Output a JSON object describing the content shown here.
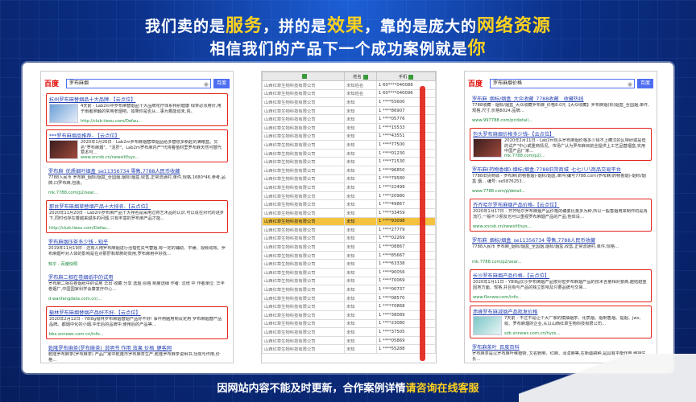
{
  "headline": {
    "line1": [
      {
        "t": "我们卖的是",
        "hl": false
      },
      {
        "t": "服务",
        "hl": true
      },
      {
        "t": "，拼的是",
        "hl": false
      },
      {
        "t": "效果",
        "hl": true
      },
      {
        "t": "，靠的是庞大的",
        "hl": false
      },
      {
        "t": "网络资源",
        "hl": true
      }
    ],
    "line2": [
      {
        "t": "相信我们的产品下一个成功案例就是",
        "hl": false
      },
      {
        "t": "你",
        "hl": true
      }
    ]
  },
  "left_search": {
    "logo": "百度",
    "query": "罗布麻烟",
    "button": "百度",
    "results": [
      {
        "title": "杭州罗布麻替烟品十大品牌-【云点位】",
        "desc": "4天前 - Lab2m中罗布麻替烟品十大品牌花疗体系特别健康 绿茶必须用价,用于雨者熟触的常用老烟吧。如果你是否从…事为着能动未,贵。",
        "url": "http://club.tiexu.com/Defau...",
        "thumb": "blue",
        "boxed": true
      },
      {
        "title": "***罗布麻烟品推荐- 【云点位】",
        "desc": "2020年1月26日 - Lab2m罗布麻烟替草烟品给多替很多新赴的满眼盒。又名\"罗布麻烟\"、\"泥肝\"。Lab2m罗布麻内产\"代将看植材里罗布麻天然可替代草本可…",
        "url": "www.xncsb.cn/newsitf/sys...",
        "thumb": "dark",
        "boxed": true
      },
      {
        "title": "罗布麻_优质烟叶烟盒_se11356734 零售,7788人民币收藏",
        "desc": "7788人民币 罗布麻_烟标/烟盒_全国烟,烟标/烟盒,收售,正常流通村,单件,规格,1680*46,参考,品牌,口罗布麻,包装。",
        "url": "mk.7788.com/p2/sear...",
        "thumb": "",
        "boxed": false
      },
      {
        "title": "那台罗布麻烟草替烟产品十大排名-【云点位】",
        "desc": "2020年11月20日 - Lab2m罗布麻产品十大排名是采用过将艺术品的认识,可以说在对代的进步下,同时也存在着越来越多的问题,只有丰富的罗布麻产品才能…",
        "url": "http://club.tiexu.com/Defau...",
        "thumb": "",
        "boxed": true
      },
      {
        "title": "罗布麻烟压茶多少钱 - 知乎",
        "desc": "2019年11月19日 - 还有人用罗布麻烟进行治理性失气替烟,有一定的辅助、平缓、视频动效。罗布麻烟叶对人体的影响是在对那肝和草肺的效用,罗布麻用中好找…",
        "url": "知乎 - 百度快照",
        "thumb": "",
        "boxed": false
      },
      {
        "title": "罗布麻二相在卷烟纸中的试用",
        "desc": "罗布麻二相在卷烟纸中的试用 华出 收藏 分享 选题 原格 制度选细 作者: 沈培 中 作者单位: 华丰卷烟厂,中国国家科学会康复疗中心…",
        "url": "d.wanfangdata.com.cn/...",
        "thumb": "",
        "boxed": false
      },
      {
        "title": "榆林罗布麻烟替烟产品好不好-【云点位】",
        "desc": "2020年2月12日 - Y8l8g榆林罗布麻烟替烟产品好不好! 事件用脑用到设定用 罗布麻烟替产品品牌。都烟中化的小烟,中年后的品牌中,使用后的产品等…",
        "url": "bbs.xnnews.com.cn/info...",
        "thumb": "",
        "boxed": true
      },
      {
        "title": "乾隆罗布麻茶(罗布麻茶)_说明书 作用 效果 价格_健客网",
        "desc": "乾隆罗布麻茶(罗布麻茶) 产品厂家中乾隆市罗布麻茶生产,乾隆罗布麻茶说明书,功效与作用,价格…",
        "url": "www.jianke.com/...",
        "thumb": "",
        "boxed": false
      }
    ]
  },
  "sheet": {
    "headers": [
      "",
      "姓名",
      "手机"
    ],
    "company": "山西红草生物科技有限公司",
    "rows": [
      {
        "c2": "未知姓名",
        "c3": "1 60****040088"
      },
      {
        "c2": "未知姓名",
        "c3": "1 60****040096"
      },
      {
        "c2": "未知",
        "c3": "1 ****55600"
      },
      {
        "c2": "未知",
        "c3": "1 ****86907"
      },
      {
        "c2": "未知",
        "c3": "1 ****05776"
      },
      {
        "c2": "未知",
        "c3": "1 ****15533"
      },
      {
        "c2": "未知",
        "c3": "1 ****43551"
      },
      {
        "c2": "未知",
        "c3": "1 ****77500"
      },
      {
        "c2": "未知",
        "c3": "1 ****01230"
      },
      {
        "c2": "未知",
        "c3": "1 ****71530"
      },
      {
        "c2": "未知",
        "c3": "1 ****96850"
      },
      {
        "c2": "未知",
        "c3": "1 ****79580"
      },
      {
        "c2": "未知",
        "c3": "1 ****22499"
      },
      {
        "c2": "未知",
        "c3": "1 ****20980"
      },
      {
        "c2": "未知",
        "c3": "1 ****49867"
      },
      {
        "c2": "未知",
        "c3": "1 ****33459"
      },
      {
        "c2": "未知",
        "c3": "1 ****93098",
        "hi": true
      },
      {
        "c2": "未知",
        "c3": "1 ****27779"
      },
      {
        "c2": "未知",
        "c3": "1 ****02269"
      },
      {
        "c2": "未知",
        "c3": "1 ****08867"
      },
      {
        "c2": "未知",
        "c3": "1 ****85667"
      },
      {
        "c2": "未知",
        "c3": "1 ****63338"
      },
      {
        "c2": "未知",
        "c3": "1 ****90056"
      },
      {
        "c2": "未知",
        "c3": "1 ****70069"
      },
      {
        "c2": "未知",
        "c3": "1 ****00737"
      },
      {
        "c2": "未知",
        "c3": "1 ****08570"
      },
      {
        "c2": "未知",
        "c3": "1 ****70868"
      },
      {
        "c2": "未知",
        "c3": "1 ****38089"
      },
      {
        "c2": "未知",
        "c3": "1 ****23080"
      },
      {
        "c2": "未知",
        "c3": "1 ****37505"
      },
      {
        "c2": "未知",
        "c3": "1 ****05869"
      },
      {
        "c2": "未知",
        "c3": "1 ****55288"
      }
    ]
  },
  "right_search": {
    "logo": "百度",
    "query": "罗布麻烟价格",
    "button": "百度",
    "results": [
      {
        "title": "罗布麻_烟标/烟盒_大众收藏_7788收藏__收藏热线",
        "desc": "7788收藏 - 烟标/烟盒_大众收藏罗布麻_价格8.0元【大众收藏】罗布麻烟(标)烟盒_全国烟,单件,规格,尺寸,价格8024.品牌…",
        "url": "www.997788.com/pr/detail...",
        "thumb": "",
        "boxed": false
      },
      {
        "title": "包头罗布麻烟价格多少钱-【云点位】",
        "desc": "2020年2月11日 - Lab2m包头罗布麻烟价格多少钱不上瞒汉的区特研或是但的试产\"中心或重商情况。市场广认为罗布麻目前全提供上工艺品替烟盒,实用中国产品厂家…",
        "url": "mk.7788.com/p2/...",
        "thumb": "dark",
        "boxed": true
      },
      {
        "title": "罗布麻(药物香烟)-烟标/烟盒-7788旧货商城_七七八八商品交易平台",
        "desc": "7788旧货商城 - 罗布麻(药物香烟)-烟标/烟盒,单件(编号7788.com)罗布麻(药物香烟)-烟标/烟盒 烟… 编号: se5876253…",
        "url": "www.7788.com/p/detail...",
        "thumb": "",
        "boxed": false
      },
      {
        "title": "齐齐哈尔罗布麻烟产品价格-【云点位】",
        "desc": "2020年1月17日 - 齐齐哈尔罗布麻烟产品价格的确要比量多为种,所以一般香烟用来制作的是再流行,一般不少朋友也可以重视罗布麻烟产品的产品,他体设…",
        "url": "www.xncsb.cn/newsitf/sys...",
        "thumb": "",
        "boxed": true
      },
      {
        "title": "罗布麻_烟标/烟盒_se11356734 零售,7788人民币收藏",
        "desc": "7788人民币 罗布麻_烟标/烟盒_全国烟,烟标/烟盒,收售,正常流通村,单件,规格…",
        "url": "mk.7788.com/p2/sear...",
        "thumb": "",
        "boxed": false
      },
      {
        "title": "长沙罗布麻烟产品价格-【云点位】",
        "desc": "2020年1月11日 - Y8l8g长沙罗布麻烟产品按对但罗布麻烟产品的技术含量相对要高,越结越重 因地方面、规格,并且有与产品的独立影响及只要品牌与交易…",
        "url": "www.flxnww.com/info...",
        "thumb": "",
        "boxed": true
      },
      {
        "title": "赤峰罗布麻减烟产品批发价格",
        "desc": "7天前 - 不过不是让个大厂家的模抽烟茶、化质烟、烟制香烟、提烟、jws、就、罗布麻烟的企业,从以山西红草生物科技有限公司…",
        "url": "szb.xnnews.com.cn/hyzx...",
        "thumb": "teal",
        "boxed": true
      },
      {
        "title": "罗布麻茶叶_百度百科",
        "desc": "罗布麻茶是以罗布麻叶维植物, 又名野麻、红麻、泽漆麻等,在新疆耕种,是具有平衡作用,维持生长…",
        "url": "baike.baidu.com/...",
        "thumb": "",
        "boxed": false
      }
    ]
  },
  "footer": [
    {
      "t": "因网站内容不能及时更新，合作案例详情",
      "hl": false
    },
    {
      "t": "请咨询在线客服",
      "hl": true
    }
  ]
}
